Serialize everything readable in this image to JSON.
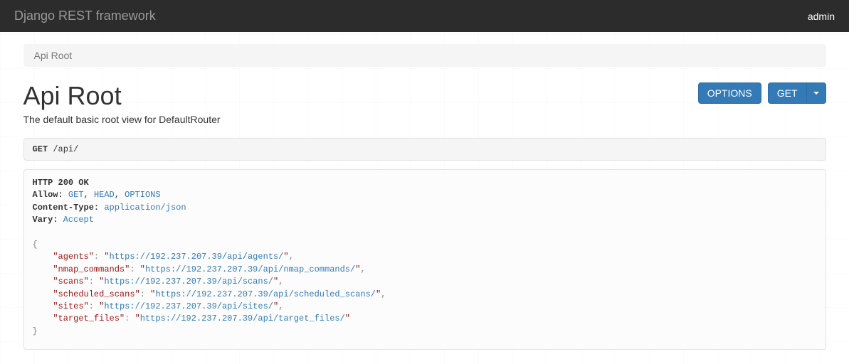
{
  "navbar": {
    "brand": "Django REST framework",
    "user": "admin"
  },
  "breadcrumb": {
    "current": "Api Root"
  },
  "page": {
    "title": "Api Root",
    "description": "The default basic root view for DefaultRouter"
  },
  "buttons": {
    "options": "OPTIONS",
    "get": "GET"
  },
  "request": {
    "method": "GET",
    "path": "/api/"
  },
  "response": {
    "status_line": "HTTP 200 OK",
    "headers": [
      {
        "name": "Allow",
        "value": "GET, HEAD, OPTIONS"
      },
      {
        "name": "Content-Type",
        "value": "application/json"
      },
      {
        "name": "Vary",
        "value": "Accept"
      }
    ],
    "body_entries": [
      {
        "key": "agents",
        "value": "https://192.237.207.39/api/agents/"
      },
      {
        "key": "nmap_commands",
        "value": "https://192.237.207.39/api/nmap_commands/"
      },
      {
        "key": "scans",
        "value": "https://192.237.207.39/api/scans/"
      },
      {
        "key": "scheduled_scans",
        "value": "https://192.237.207.39/api/scheduled_scans/"
      },
      {
        "key": "sites",
        "value": "https://192.237.207.39/api/sites/"
      },
      {
        "key": "target_files",
        "value": "https://192.237.207.39/api/target_files/"
      }
    ]
  }
}
